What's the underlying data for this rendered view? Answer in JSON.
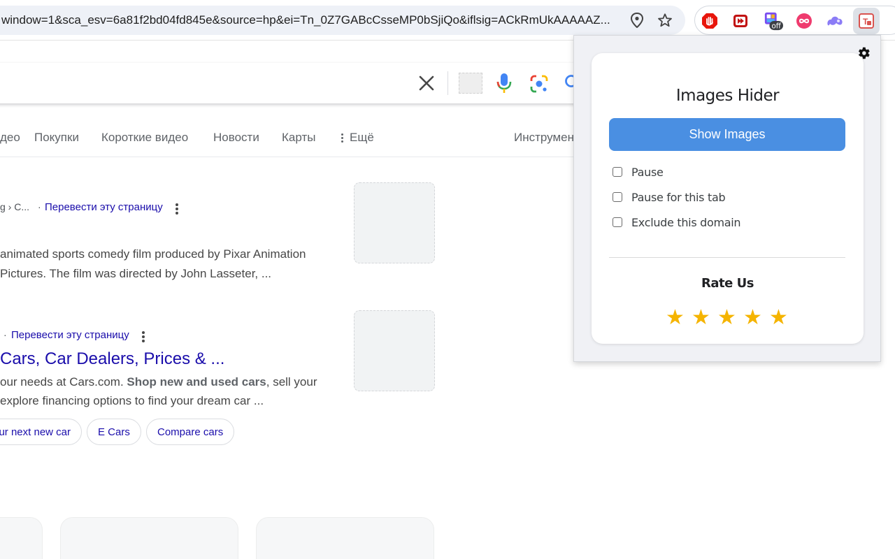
{
  "browser": {
    "url": "window=1&sca_esv=6a81f2bd04fd845e&source=hp&ei=Tn_0Z7GABcCsseMP0bSjiQo&iflsig=ACkRmUkAAAAAZ...",
    "icons": [
      "location-icon",
      "bookmark-star-icon"
    ],
    "extensions": [
      {
        "name": "ublock-icon",
        "color": "#e8160c"
      },
      {
        "name": "video-ext-icon",
        "color": "#c21313"
      },
      {
        "name": "toggle-ext-icon",
        "badge": "off"
      },
      {
        "name": "infinity-ext-icon",
        "color": "#e91e63"
      },
      {
        "name": "cloud-ext-icon",
        "color": "#8b7cf6"
      },
      {
        "name": "images-hider-icon",
        "color": "#d9534f"
      }
    ]
  },
  "search": {
    "icons": [
      "clear-icon",
      "image-placeholder",
      "mic-icon",
      "lens-icon",
      "search-icon"
    ]
  },
  "tabs": {
    "items": [
      "део",
      "Покупки",
      "Короткие видео",
      "Новости",
      "Карты",
      "Ещё"
    ],
    "tools": "Инструмен"
  },
  "results": [
    {
      "crumb": "g › C...",
      "translate": "Перевести эту страницу",
      "snippet": [
        "animated sports comedy film produced by Pixar Animation",
        "Pictures. The film was directed by John Lasseter, ..."
      ]
    },
    {
      "crumb": "·",
      "translate": "Перевести эту страницу",
      "title": "Cars, Car Dealers, Prices & ...",
      "snippet_pre1": "our needs at Cars.com. ",
      "snippet_bold": "Shop new and used cars",
      "snippet_post1": ", sell your",
      "snippet2": "explore financing options to find your dream car ...",
      "chips": [
        "ur next new car",
        "E Cars",
        "Compare cars"
      ]
    }
  ],
  "popup": {
    "title": "Images Hider",
    "show_button": "Show Images",
    "options": [
      {
        "label": "Pause",
        "checked": false
      },
      {
        "label": "Pause for this tab",
        "checked": false
      },
      {
        "label": "Exclude this domain",
        "checked": false
      }
    ],
    "rate_label": "Rate Us",
    "rating_stars": 5,
    "star_color": "#f5b400",
    "button_color": "#4a8fe2"
  }
}
